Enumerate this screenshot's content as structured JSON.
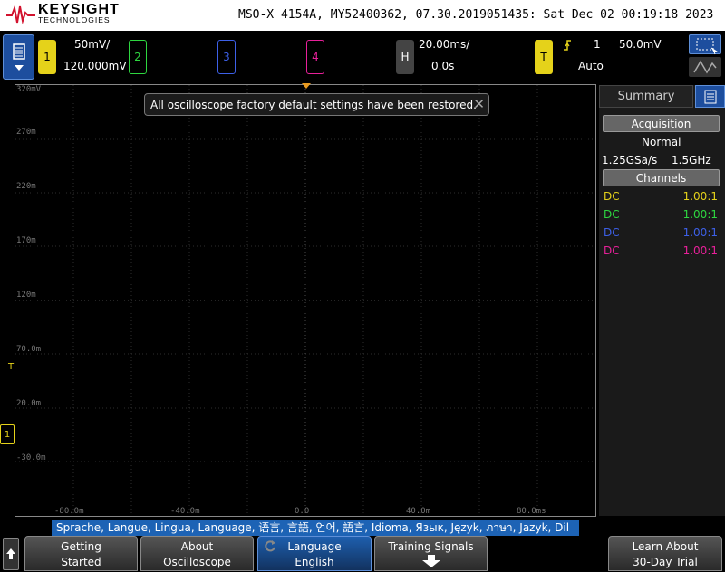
{
  "header": {
    "brand": "KEYSIGHT",
    "brand_sub": "TECHNOLOGIES",
    "model_info": "MSO-X 4154A, MY52400362, 07.30.2019051435: Sat Dec 02 00:19:18 2023"
  },
  "toolbar": {
    "ch1": {
      "num": "1",
      "scale": "50mV/",
      "offset": "120.000mV"
    },
    "ch2": {
      "num": "2"
    },
    "ch3": {
      "num": "3"
    },
    "ch4": {
      "num": "4"
    },
    "horizontal": {
      "label": "H",
      "scale": "20.00ms/",
      "delay": "0.0s"
    },
    "trigger": {
      "label": "T",
      "source": "1",
      "level": "50.0mV",
      "mode": "Auto"
    }
  },
  "display": {
    "y_labels": [
      "320mV",
      "270m",
      "220m",
      "170m",
      "120m",
      "70.0m",
      "20.0m",
      "-30.0m"
    ],
    "x_labels": [
      "-80.0m",
      "-40.0m",
      "0.0",
      "40.0m",
      "80.0ms"
    ],
    "toast": "All oscilloscope factory default settings have been restored.",
    "trigger_marker": "T",
    "ground_marker": "1"
  },
  "panel": {
    "tab": "Summary",
    "acquisition_head": "Acquisition",
    "acq_mode": "Normal",
    "sample_rate": "1.25GSa/s",
    "bandwidth": "1.5GHz",
    "channels_head": "Channels",
    "channels": [
      {
        "coupling": "DC",
        "ratio": "1.00:1",
        "color": "#e5d21a"
      },
      {
        "coupling": "DC",
        "ratio": "1.00:1",
        "color": "#2ed640"
      },
      {
        "coupling": "DC",
        "ratio": "1.00:1",
        "color": "#3d60e8"
      },
      {
        "coupling": "DC",
        "ratio": "1.00:1",
        "color": "#e8209a"
      }
    ]
  },
  "bottom": {
    "lang_strip": "Sprache, Langue, Lingua, Language, 语言, 言語, 언어, 語言, Idioma, Язык, Język, ภาษา, Jazyk, Dil",
    "softkeys": {
      "getting_started": [
        "Getting",
        "Started"
      ],
      "about": [
        "About",
        "Oscilloscope"
      ],
      "language": [
        "Language",
        "English"
      ],
      "training": [
        "Training Signals"
      ],
      "trial": [
        "Learn About",
        "30-Day Trial"
      ]
    }
  }
}
